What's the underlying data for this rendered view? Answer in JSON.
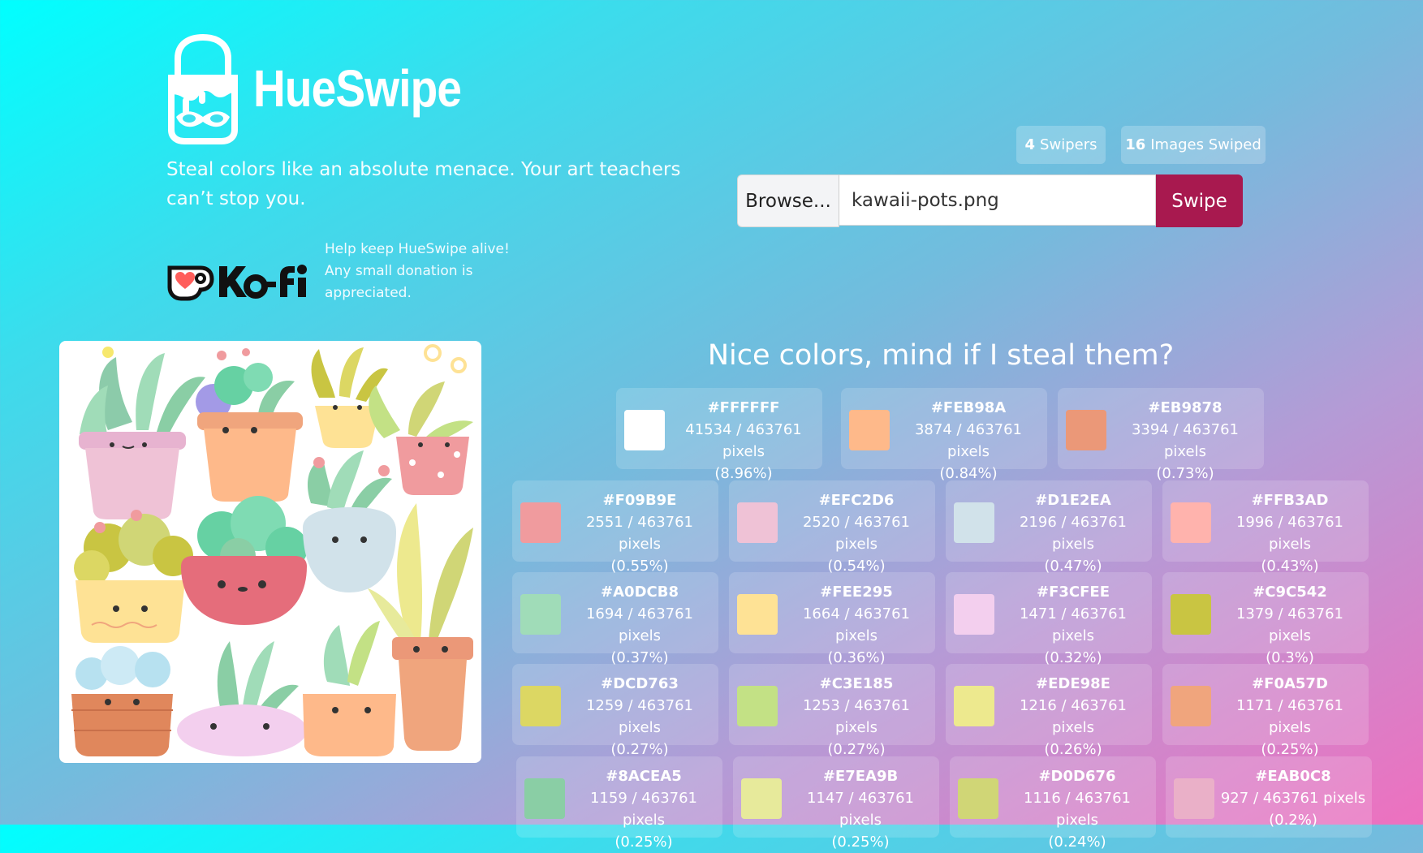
{
  "brand": {
    "name": "HueSwipe",
    "tagline": "Steal colors like an absolute menace. Your art teachers can’t stop you."
  },
  "kofi": {
    "message": "Help keep HueSwipe alive! Any small donation is appreciated."
  },
  "stats": {
    "swipers_count": "4",
    "swipers_label": "Swipers",
    "images_count": "16",
    "images_label": "Images Swiped"
  },
  "upload": {
    "browse_label": "Browse...",
    "file_name": "kawaii-pots.png",
    "submit_label": "Swipe"
  },
  "results": {
    "heading": "Nice colors, mind if I steal them?",
    "colors": [
      {
        "hex": "#FFFFFF",
        "pixels": "41534 / 463761 pixels",
        "percent": "(8.96%)"
      },
      {
        "hex": "#FEB98A",
        "pixels": "3874 / 463761 pixels",
        "percent": "(0.84%)"
      },
      {
        "hex": "#EB9878",
        "pixels": "3394 / 463761 pixels",
        "percent": "(0.73%)"
      },
      {
        "hex": "#F09B9E",
        "pixels": "2551 / 463761 pixels",
        "percent": "(0.55%)"
      },
      {
        "hex": "#EFC2D6",
        "pixels": "2520 / 463761 pixels",
        "percent": "(0.54%)"
      },
      {
        "hex": "#D1E2EA",
        "pixels": "2196 / 463761 pixels",
        "percent": "(0.47%)"
      },
      {
        "hex": "#FFB3AD",
        "pixels": "1996 / 463761 pixels",
        "percent": "(0.43%)"
      },
      {
        "hex": "#A0DCB8",
        "pixels": "1694 / 463761 pixels",
        "percent": "(0.37%)"
      },
      {
        "hex": "#FEE295",
        "pixels": "1664 / 463761 pixels",
        "percent": "(0.36%)"
      },
      {
        "hex": "#F3CFEE",
        "pixels": "1471 / 463761 pixels",
        "percent": "(0.32%)"
      },
      {
        "hex": "#C9C542",
        "pixels": "1379 / 463761 pixels",
        "percent": "(0.3%)"
      },
      {
        "hex": "#DCD763",
        "pixels": "1259 / 463761 pixels",
        "percent": "(0.27%)"
      },
      {
        "hex": "#C3E185",
        "pixels": "1253 / 463761 pixels",
        "percent": "(0.27%)"
      },
      {
        "hex": "#EDE98E",
        "pixels": "1216 / 463761 pixels",
        "percent": "(0.26%)"
      },
      {
        "hex": "#F0A57D",
        "pixels": "1171 / 463761 pixels",
        "percent": "(0.25%)"
      },
      {
        "hex": "#8ACEA5",
        "pixels": "1159 / 463761 pixels",
        "percent": "(0.25%)"
      },
      {
        "hex": "#E7EA9B",
        "pixels": "1147 / 463761 pixels",
        "percent": "(0.25%)"
      },
      {
        "hex": "#D0D676",
        "pixels": "1116 / 463761 pixels",
        "percent": "(0.24%)"
      },
      {
        "hex": "#EAB0C8",
        "pixels": "927 / 463761 pixels",
        "percent": "(0.2%)"
      }
    ]
  },
  "colors": {
    "swipe_button": "#a8194f",
    "kofi_cup": "#ff5e5b"
  }
}
